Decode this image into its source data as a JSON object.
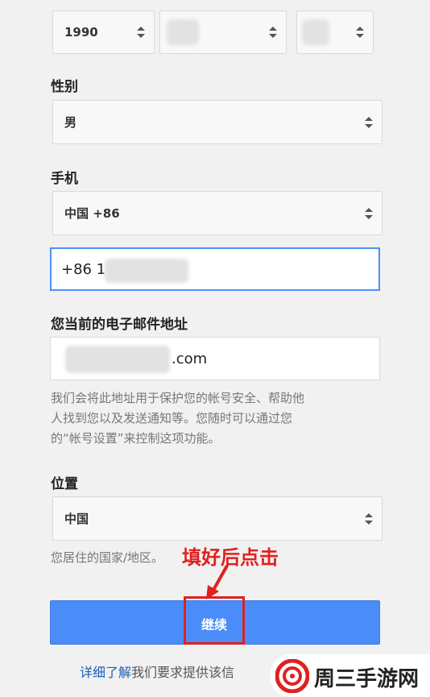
{
  "birthday": {
    "year": "1990",
    "month": "",
    "day": ""
  },
  "gender": {
    "label": "性别",
    "value": "男"
  },
  "phone": {
    "label": "手机",
    "country": "中国 +86",
    "number_visible": "+86 1"
  },
  "email": {
    "label": "您当前的电子邮件地址",
    "value_visible": ".com",
    "help_lines": [
      "我们会将此地址用于保护您的帐号安全、帮助他",
      "人找到您以及发送通知等。您随时可以通过您",
      "的“帐号设置”来控制这项功能。"
    ]
  },
  "location": {
    "label": "位置",
    "value": "中国",
    "help": "您居住的国家/地区。"
  },
  "annotation": {
    "text": "填好后点击",
    "color": "#e02020"
  },
  "continue_button": {
    "label": "继续"
  },
  "footer": {
    "link": "详细了解",
    "text": "我们要求提供该信"
  },
  "watermark": {
    "text": "周三手游网"
  },
  "colors": {
    "accent": "#4b8df8",
    "focus_border": "#4d90fe"
  }
}
